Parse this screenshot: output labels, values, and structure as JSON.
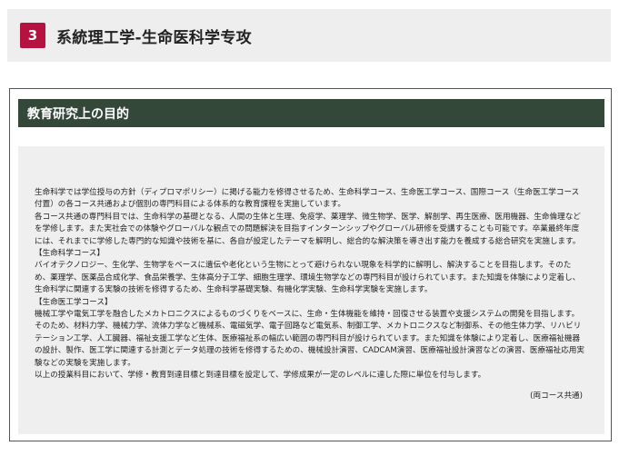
{
  "section": {
    "number": "3",
    "title": "系統理工学-生命医科学专攻"
  },
  "panel": {
    "heading": "教育研究上の目的",
    "paragraphs": [
      "生命科学では学位授与の方針（ディプロマポリシー）に掲げる能力を修得させるため、生命科学コース、生命医工学コース、国際コース（生命医工学コース付置）の各コース共通および個別の専門科目による体系的な教育課程を実施しています。",
      "各コース共通の専門科目では、生命科学の基礎となる、人間の生体と生理、免疫学、薬理学、微生物学、医学、解剖学、再生医療、医用機器、生命倫理などを学修します。また実社会での体験やグローバルな観点での問題解決を目指すインターンシップやグローバル研修を受講することも可能です。卒業最終年度には、それまでに学修した専門的な知識や技術を基に、各自が設定したテーマを解明し、総合的な解決策を導き出す能力を養成する総合研究を実施します。",
      "【生命科学コース】",
      "バイオテクノロジー、生化学、生物学をベースに遺伝や老化という生物にとって避けられない現象を科学的に解明し、解決することを目指します。そのため、薬理学、医薬品合成化学、食品栄養学、生体高分子工学、細胞生理学、環境生物学などの専門科目が設けられています。また知識を体験により定着し、生命科学に関連する実験の技術を修得するため、生命科学基礎実験、有機化学実験、生命科学実験を実施します。",
      "【生命医工学コース】",
      "機械工学や電気工学を融合したメカトロニクスによるものづくりをベースに、生命・生体機能を維持・回復させる装置や支援システムの開発を目指します。そのため、材料力学、機械力学、流体力学など機械系、電磁気学、電子回路など電気系、制御工学、メカトロニクスなど制御系、その他生体力学、リハビリテーション工学、人工臓器、福祉支援工学など生体、医療福祉系の幅広い範囲の専門科目が設けられています。また知識を体験により定着し、医療福祉機器の設計、製作、医工学に関連する計測とデータ処理の技術を修得するための、機械設計演習、CADCAM演習、医療福祉設計演習などの演習、医療福祉応用実験などの実験を実施します。",
      "以上の授業科目において、学修・教育到達目標と到達目標を設定して、学修成果が一定のレベルに達した際に単位を付与します。"
    ],
    "footnote": "(両コース共通)"
  }
}
